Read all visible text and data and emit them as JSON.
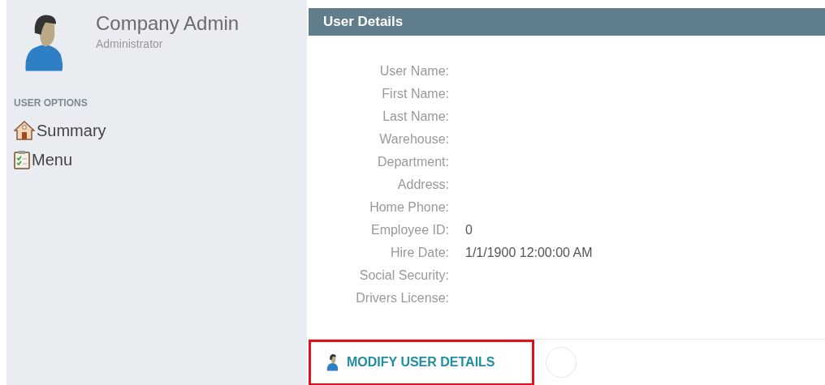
{
  "profile": {
    "name": "Company Admin",
    "role": "Administrator"
  },
  "sidebar": {
    "heading": "USER OPTIONS",
    "items": [
      {
        "label": "Summary",
        "kind": "home"
      },
      {
        "label": "Menu",
        "kind": "clipboard"
      }
    ]
  },
  "panel": {
    "title": "User Details",
    "fields": [
      {
        "label": "User Name:"
      },
      {
        "label": "First Name:"
      },
      {
        "label": "Last Name:"
      },
      {
        "label": "Warehouse:"
      },
      {
        "label": "Department:"
      },
      {
        "label": "Address:"
      },
      {
        "label": "Home Phone:"
      },
      {
        "label": "Employee ID:",
        "value": "0"
      },
      {
        "label": "Hire Date:",
        "value": "1/1/1900 12:00:00 AM"
      },
      {
        "label": "Social Security:"
      },
      {
        "label": "Drivers License:"
      }
    ],
    "action": {
      "label": "MODIFY USER DETAILS",
      "highlighted": true
    }
  }
}
